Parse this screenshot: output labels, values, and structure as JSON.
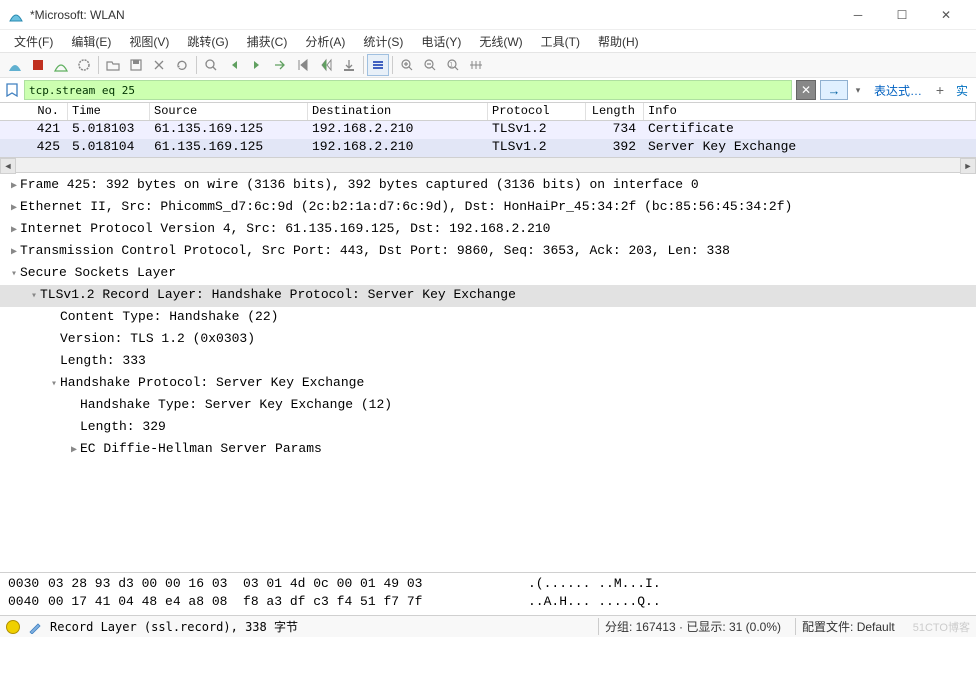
{
  "title": "*Microsoft: WLAN",
  "menus": [
    "文件(F)",
    "编辑(E)",
    "视图(V)",
    "跳转(G)",
    "捕获(C)",
    "分析(A)",
    "统计(S)",
    "电话(Y)",
    "无线(W)",
    "工具(T)",
    "帮助(H)"
  ],
  "filter": {
    "value": "tcp.stream eq 25",
    "expr_label": "表达式…",
    "plus": "+",
    "trailing": "实"
  },
  "packet_headers": [
    "No.",
    "Time",
    "Source",
    "Destination",
    "Protocol",
    "Length",
    "Info"
  ],
  "packets": [
    {
      "no": "421",
      "time": "5.018103",
      "src": "61.135.169.125",
      "dst": "192.168.2.210",
      "proto": "TLSv1.2",
      "len": "734",
      "info": "Certificate"
    },
    {
      "no": "425",
      "time": "5.018104",
      "src": "61.135.169.125",
      "dst": "192.168.2.210",
      "proto": "TLSv1.2",
      "len": "392",
      "info": "Server Key Exchange"
    }
  ],
  "details": {
    "frame": "Frame 425: 392 bytes on wire (3136 bits), 392 bytes captured (3136 bits) on interface 0",
    "eth": "Ethernet II, Src: PhicommS_d7:6c:9d (2c:b2:1a:d7:6c:9d), Dst: HonHaiPr_45:34:2f (bc:85:56:45:34:2f)",
    "ip": "Internet Protocol Version 4, Src: 61.135.169.125, Dst: 192.168.2.210",
    "tcp": "Transmission Control Protocol, Src Port: 443, Dst Port: 9860, Seq: 3653, Ack: 203, Len: 338",
    "ssl": "Secure Sockets Layer",
    "record": "TLSv1.2 Record Layer: Handshake Protocol: Server Key Exchange",
    "ct": "Content Type: Handshake (22)",
    "ver": "Version: TLS 1.2 (0x0303)",
    "len": "Length: 333",
    "hs": "Handshake Protocol: Server Key Exchange",
    "hs_type": "Handshake Type: Server Key Exchange (12)",
    "hs_len": "Length: 329",
    "ecdh": "EC Diffie-Hellman Server Params"
  },
  "hex": [
    {
      "off": "0030",
      "bytes": "03 28 93 d3 00 00 16 03  03 01 4d 0c 00 01 49 03",
      "ascii": ".(...... ..M...I."
    },
    {
      "off": "0040",
      "bytes": "00 17 41 04 48 e4 a8 08  f8 a3 df c3 f4 51 f7 7f",
      "ascii": "..A.H... .....Q.."
    }
  ],
  "status": {
    "msg": "Record Layer (ssl.record), 338 字节",
    "packets": "分组: 167413 · 已显示: 31 (0.0%)",
    "profile_label": "配置文件:",
    "profile_value": "Default",
    "watermark": "51CTO博客"
  }
}
